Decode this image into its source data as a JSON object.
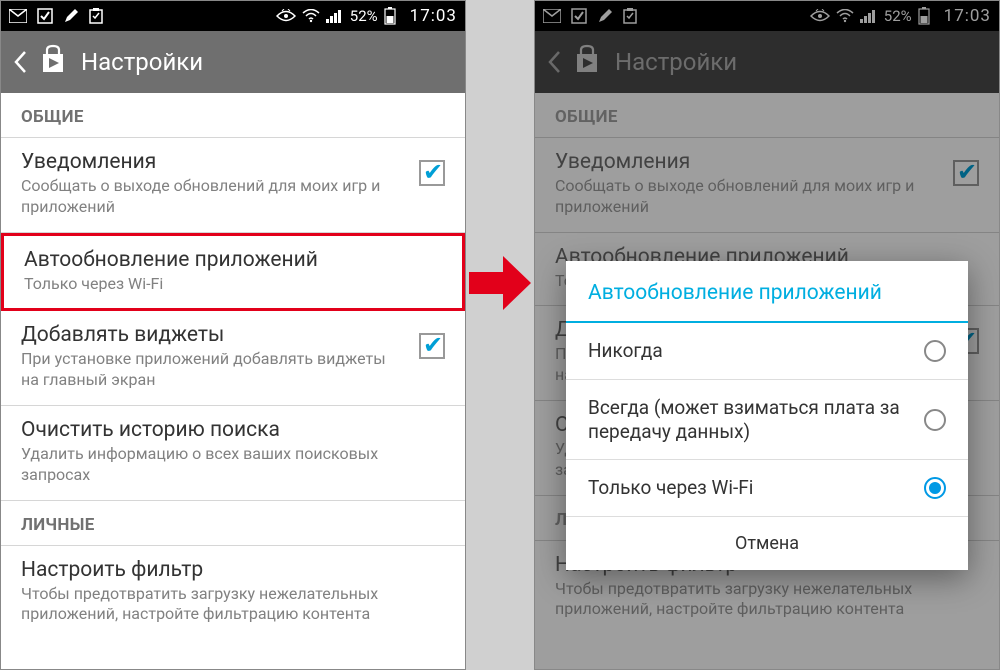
{
  "status": {
    "battery_pct": "52%",
    "time": "17:03"
  },
  "appbar": {
    "title": "Настройки"
  },
  "sections": {
    "general": "ОБЩИЕ",
    "personal": "ЛИЧНЫЕ"
  },
  "items": {
    "notifications": {
      "title": "Уведомления",
      "sub": "Сообщать о выходе обновлений для моих игр и приложений"
    },
    "autoupdate": {
      "title": "Автообновление приложений",
      "sub": "Только через Wi-Fi"
    },
    "widgets": {
      "title": "Добавлять виджеты",
      "sub": "При установке приложений добавлять виджеты на главный экран"
    },
    "clearhistory": {
      "title": "Очистить историю поиска",
      "sub": "Удалить информацию о всех ваших поисковых запросах"
    },
    "filter": {
      "title": "Настроить фильтр",
      "sub": "Чтобы предотвратить загрузку нежелательных приложений, настройте фильтрацию контента"
    }
  },
  "dialog": {
    "title": "Автообновление приложений",
    "opt_never": "Никогда",
    "opt_always": "Всегда (может взиматься плата за передачу данных)",
    "opt_wifi": "Только через Wi-Fi",
    "cancel": "Отмена"
  }
}
